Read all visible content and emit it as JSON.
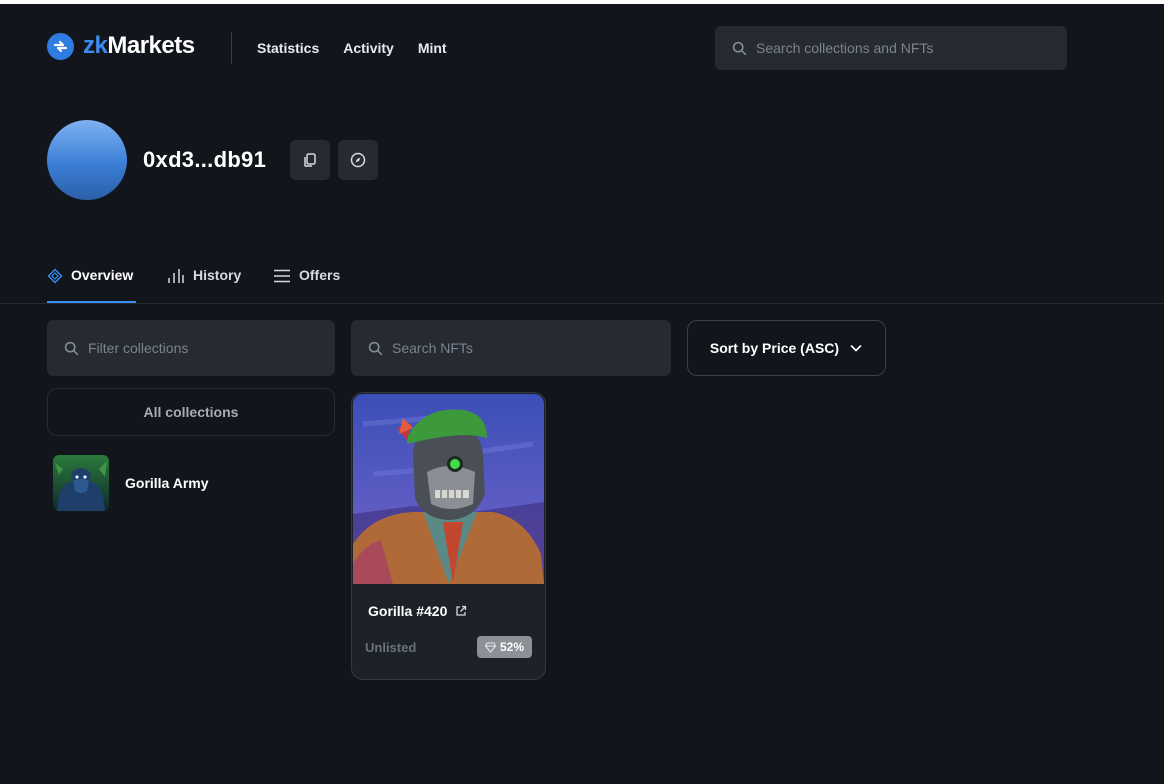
{
  "header": {
    "logo_prefix": "zk",
    "logo_suffix": "Markets",
    "nav": [
      "Statistics",
      "Activity",
      "Mint"
    ],
    "search_placeholder": "Search collections and NFTs"
  },
  "profile": {
    "address": "0xd3...db91",
    "actions": [
      "copy-icon",
      "explorer-icon"
    ]
  },
  "tabs": [
    {
      "label": "Overview",
      "icon": "overview-icon",
      "active": true
    },
    {
      "label": "History",
      "icon": "history-icon",
      "active": false
    },
    {
      "label": "Offers",
      "icon": "list-icon",
      "active": false
    }
  ],
  "filters": {
    "collections_placeholder": "Filter collections",
    "nft_placeholder": "Search NFTs",
    "sort_label": "Sort by Price (ASC)",
    "all_collections_label": "All collections"
  },
  "collections": [
    {
      "name": "Gorilla Army"
    }
  ],
  "nft_cards": [
    {
      "title": "Gorilla #420",
      "status": "Unlisted",
      "rarity": "52%"
    }
  ],
  "colors": {
    "background": "#12161c",
    "accent": "#3b8cf0",
    "surface": "#262b33"
  }
}
